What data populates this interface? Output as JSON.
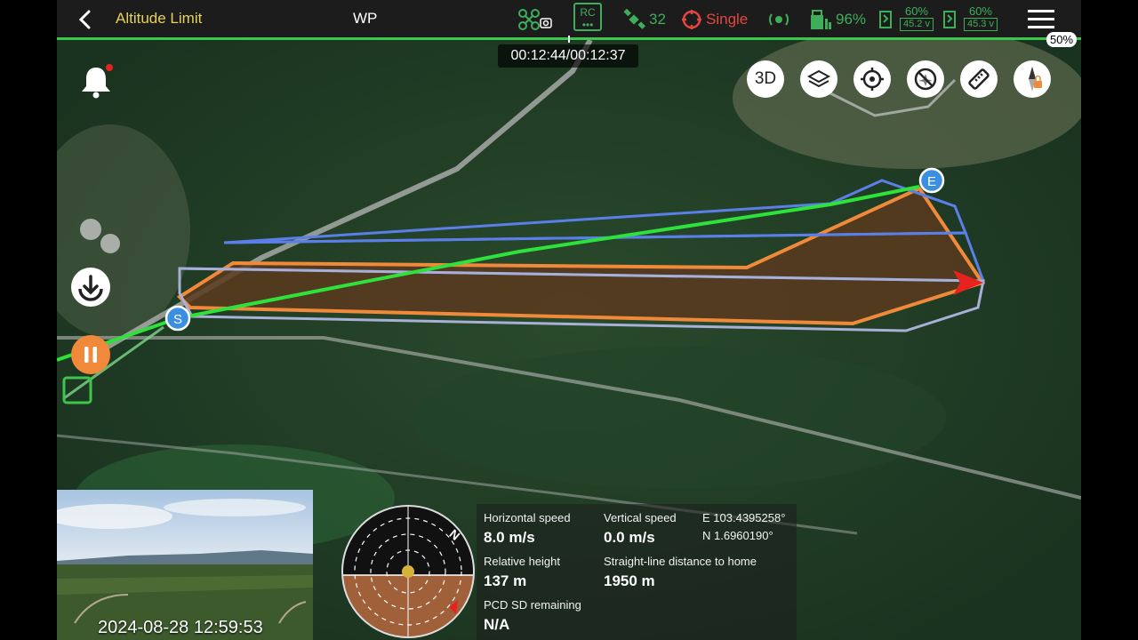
{
  "header": {
    "title": "Altitude Limit",
    "mode": "WP",
    "rc_label": "RC",
    "satellites": "32",
    "positioning": "Single",
    "battery_percent": "96%",
    "battery1": {
      "percent": "60%",
      "voltage": "45.2 v"
    },
    "battery2": {
      "percent": "60%",
      "voltage": "45.3 v"
    }
  },
  "progress": {
    "fraction": 0.5,
    "percent_label": "50%",
    "timer": "00:12:44/00:12:37"
  },
  "tools": {
    "view_3d": "3D"
  },
  "map": {
    "start_marker": "S",
    "end_marker": "E",
    "colors": {
      "route": "#2ee13b",
      "area": "#f08a3a",
      "boundary_blue": "#5b7fe8",
      "boundary_grey": "#a8b0d8"
    }
  },
  "camera": {
    "timestamp": "2024-08-28 12:59:53"
  },
  "attitude": {
    "north_label": "N"
  },
  "telemetry": {
    "horizontal_speed": {
      "label": "Horizontal speed",
      "value": "8.0 m/s"
    },
    "vertical_speed": {
      "label": "Vertical speed",
      "value": "0.0 m/s"
    },
    "longitude": "E 103.4395258°",
    "latitude": "N 1.6960190°",
    "relative_height": {
      "label": "Relative height",
      "value": "137 m"
    },
    "home_distance": {
      "label": "Straight-line distance to home",
      "value": "1950 m"
    },
    "pcd_sd": {
      "label": "PCD SD remaining",
      "value": "N/A"
    }
  },
  "icons": [
    "back-icon",
    "drone-camera-icon",
    "rc-icon",
    "satellite-icon",
    "positioning-icon",
    "gimbal-icon",
    "battery-icon",
    "menu-icon",
    "bell-icon",
    "layers-icon",
    "locate-icon",
    "no-fly-icon",
    "ruler-icon",
    "compass-icon",
    "download-icon",
    "pause-icon"
  ]
}
